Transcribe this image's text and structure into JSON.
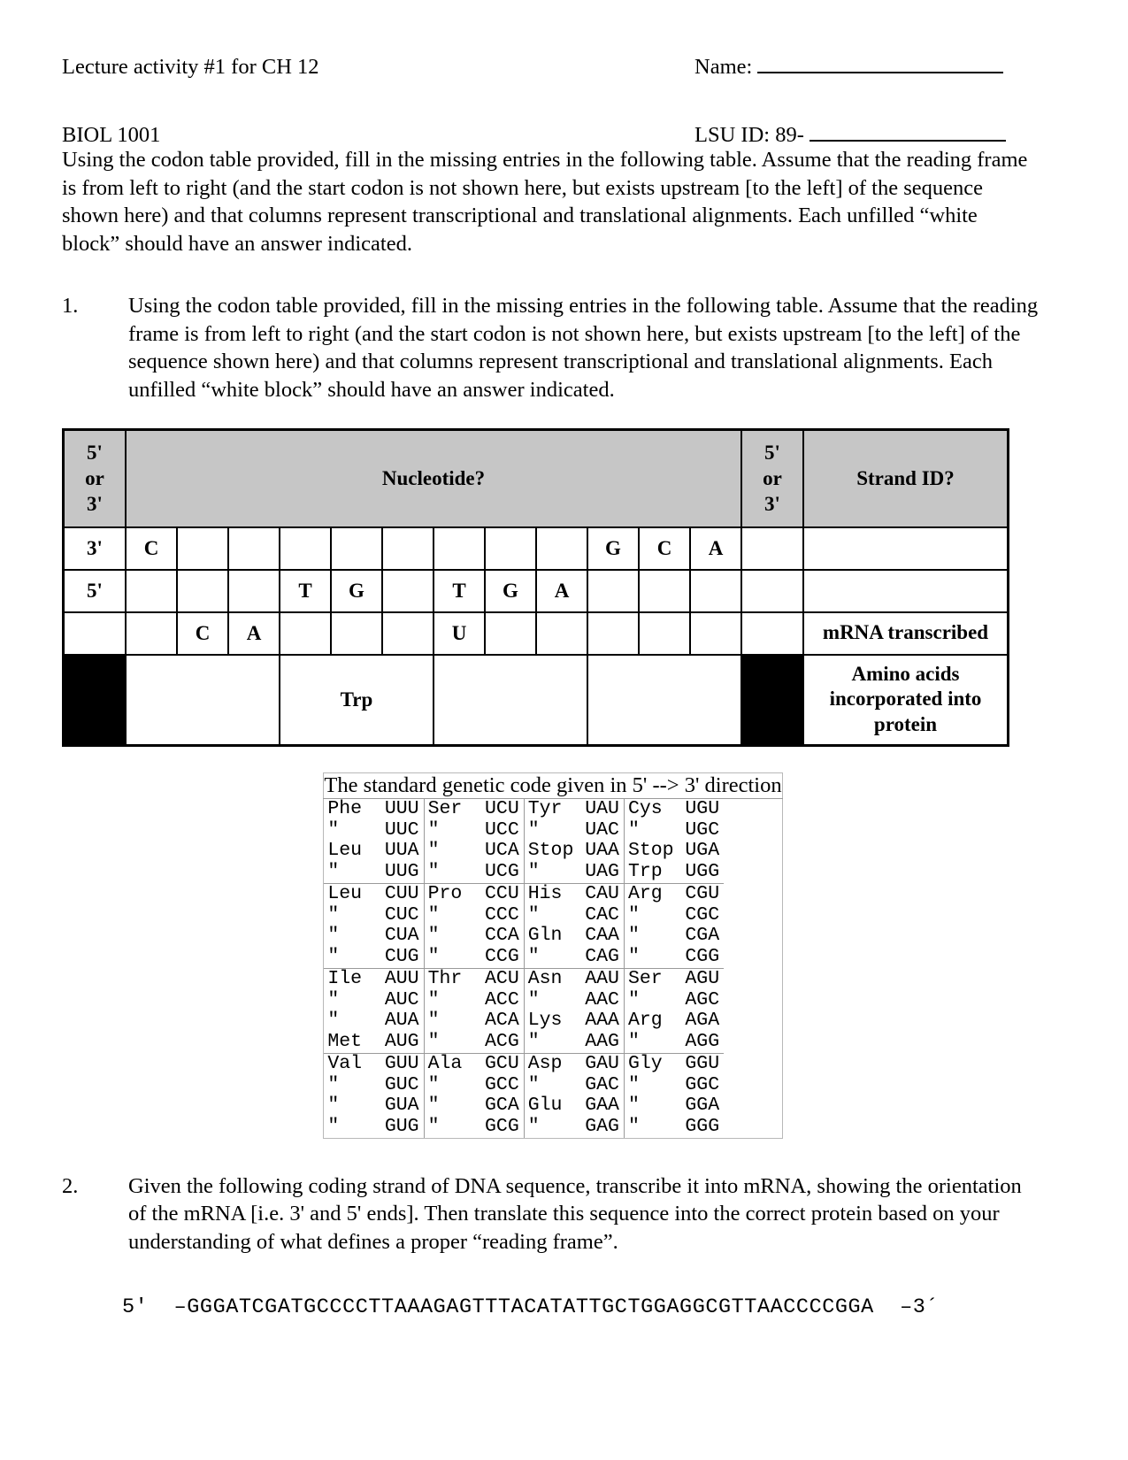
{
  "header": {
    "course_activity": "Lecture activity #1 for CH 12",
    "course_code": "BIOL 1001",
    "name_label": "Name:",
    "lsu_id_label": "LSU ID: 89-"
  },
  "intro_paragraph": "Using the codon table provided, fill in the missing entries in the following table.  Assume that the reading frame is from left to right (and the start codon is not shown here, but exists upstream [to the left] of the sequence shown here) and that columns represent transcriptional and translational alignments.  Each unfilled “white block” should have an answer indicated.",
  "questions": [
    {
      "number": "1.",
      "text": "Using the codon table provided, fill in the missing entries in the following table.  Assume that the reading frame is from left to right (and the start codon is not shown here, but exists upstream [to the left] of the sequence shown here) and that columns represent transcriptional and translational alignments.  Each unfilled “white block” should have an answer indicated."
    },
    {
      "number": "2.",
      "text": "Given the following coding strand of DNA sequence, transcribe it into mRNA, showing the orientation of the mRNA [i.e. 3' and 5' ends].  Then translate this sequence into the correct protein based on your understanding of what defines a proper “reading frame”.",
      "sequence": "5'  –GGGATCGATGCCCCTTAAAGAGTTTACATATTGCTGGAGGCGTTAACCCCGGA  –3´"
    }
  ],
  "main_table": {
    "header": {
      "left_end": [
        "5'",
        "or",
        "3'"
      ],
      "nucleotide": "Nucleotide?",
      "right_end": [
        "5'",
        "or",
        "3'"
      ],
      "strand_id": "Strand ID?",
      "header_bg": "#c6c6c6"
    },
    "rows": [
      {
        "left_end": "3'",
        "cells": [
          "C",
          "",
          "",
          "",
          "",
          "",
          "",
          "",
          "",
          "G",
          "C",
          "A"
        ],
        "right_end": "",
        "strand_id": ""
      },
      {
        "left_end": "5'",
        "cells": [
          "",
          "",
          "",
          "T",
          "G",
          "",
          "T",
          "G",
          "A",
          "",
          "",
          ""
        ],
        "right_end": "",
        "strand_id": ""
      },
      {
        "left_end": "",
        "cells": [
          "",
          "C",
          "A",
          "",
          "",
          "",
          "U",
          "",
          "",
          "",
          "",
          ""
        ],
        "right_end": "",
        "strand_id": "mRNA transcribed"
      }
    ],
    "amino_acid_row": {
      "left_end_black": true,
      "codons": [
        "",
        "Trp",
        "",
        ""
      ],
      "right_end_black": true,
      "strand_id": "Amino acids incorporated into protein"
    }
  },
  "genetic_code": {
    "title": "The standard genetic code given in 5' --> 3' direction",
    "columns": [
      [
        [
          [
            "Phe",
            "UUU"
          ],
          [
            "\"",
            "UUC"
          ],
          [
            "Leu",
            "UUA"
          ],
          [
            "\"",
            "UUG"
          ]
        ],
        [
          [
            "Leu",
            "CUU"
          ],
          [
            "\"",
            "CUC"
          ],
          [
            "\"",
            "CUA"
          ],
          [
            "\"",
            "CUG"
          ]
        ],
        [
          [
            "Ile",
            "AUU"
          ],
          [
            "\"",
            "AUC"
          ],
          [
            "\"",
            "AUA"
          ],
          [
            "Met",
            "AUG"
          ]
        ],
        [
          [
            "Val",
            "GUU"
          ],
          [
            "\"",
            "GUC"
          ],
          [
            "\"",
            "GUA"
          ],
          [
            "\"",
            "GUG"
          ]
        ]
      ],
      [
        [
          [
            "Ser",
            "UCU"
          ],
          [
            "\"",
            "UCC"
          ],
          [
            "\"",
            "UCA"
          ],
          [
            "\"",
            "UCG"
          ]
        ],
        [
          [
            "Pro",
            "CCU"
          ],
          [
            "\"",
            "CCC"
          ],
          [
            "\"",
            "CCA"
          ],
          [
            "\"",
            "CCG"
          ]
        ],
        [
          [
            "Thr",
            "ACU"
          ],
          [
            "\"",
            "ACC"
          ],
          [
            "\"",
            "ACA"
          ],
          [
            "\"",
            "ACG"
          ]
        ],
        [
          [
            "Ala",
            "GCU"
          ],
          [
            "\"",
            "GCC"
          ],
          [
            "\"",
            "GCA"
          ],
          [
            "\"",
            "GCG"
          ]
        ]
      ],
      [
        [
          [
            "Tyr",
            "UAU"
          ],
          [
            "\"",
            "UAC"
          ],
          [
            "Stop",
            "UAA"
          ],
          [
            "\"",
            "UAG"
          ]
        ],
        [
          [
            "His",
            "CAU"
          ],
          [
            "\"",
            "CAC"
          ],
          [
            "Gln",
            "CAA"
          ],
          [
            "\"",
            "CAG"
          ]
        ],
        [
          [
            "Asn",
            "AAU"
          ],
          [
            "\"",
            "AAC"
          ],
          [
            "Lys",
            "AAA"
          ],
          [
            "\"",
            "AAG"
          ]
        ],
        [
          [
            "Asp",
            "GAU"
          ],
          [
            "\"",
            "GAC"
          ],
          [
            "Glu",
            "GAA"
          ],
          [
            "\"",
            "GAG"
          ]
        ]
      ],
      [
        [
          [
            "Cys",
            "UGU"
          ],
          [
            "\"",
            "UGC"
          ],
          [
            "Stop",
            "UGA"
          ],
          [
            "Trp",
            "UGG"
          ]
        ],
        [
          [
            "Arg",
            "CGU"
          ],
          [
            "\"",
            "CGC"
          ],
          [
            "\"",
            "CGA"
          ],
          [
            "\"",
            "CGG"
          ]
        ],
        [
          [
            "Ser",
            "AGU"
          ],
          [
            "\"",
            "AGC"
          ],
          [
            "Arg",
            "AGA"
          ],
          [
            "\"",
            "AGG"
          ]
        ],
        [
          [
            "Gly",
            "GGU"
          ],
          [
            "\"",
            "GGC"
          ],
          [
            "\"",
            "GGA"
          ],
          [
            "\"",
            "GGG"
          ]
        ]
      ]
    ]
  }
}
